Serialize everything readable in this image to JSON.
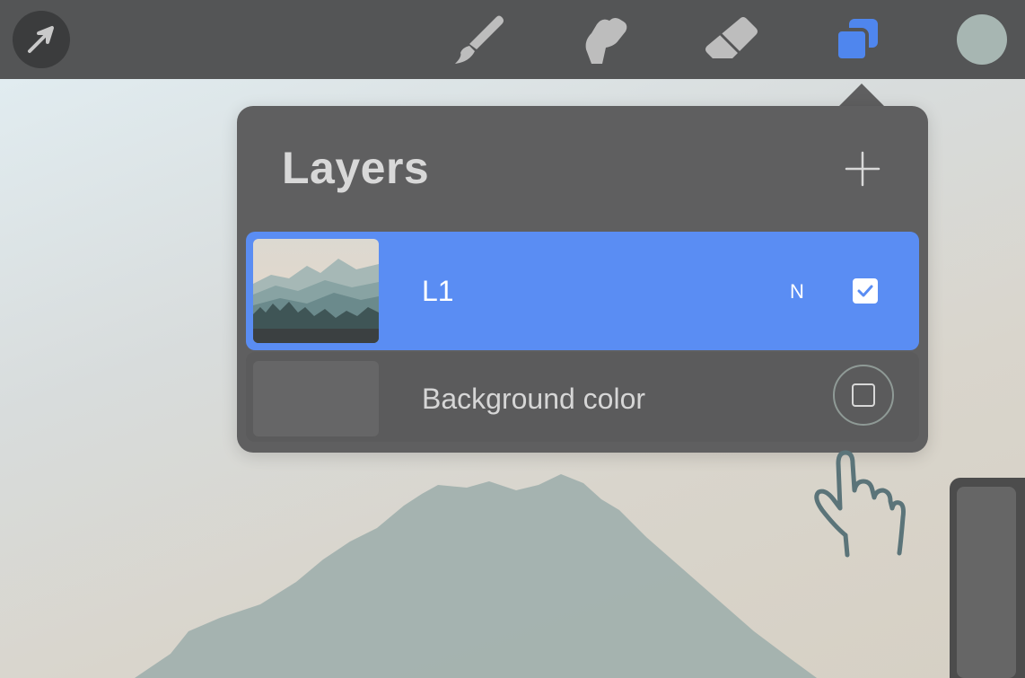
{
  "toolbar": {
    "actions_icon": "arrow-cursor-icon",
    "tools": [
      {
        "name": "brush",
        "icon": "paintbrush-icon"
      },
      {
        "name": "smudge",
        "icon": "smudge-finger-icon"
      },
      {
        "name": "eraser",
        "icon": "eraser-icon"
      },
      {
        "name": "layers",
        "icon": "layers-icon",
        "active": true
      }
    ],
    "color_swatch": "#a7b6b2",
    "accent": "#4f86ee"
  },
  "layers_panel": {
    "title": "Layers",
    "add_icon": "plus-icon",
    "layers": [
      {
        "name": "L1",
        "blend_mode": "N",
        "visible": true,
        "selected": true
      },
      {
        "name": "Background color",
        "visible": false,
        "selected": false
      }
    ]
  },
  "colors": {
    "selected_row": "#5a8df3",
    "panel": "#5f5f60",
    "toolbar": "#545556"
  }
}
